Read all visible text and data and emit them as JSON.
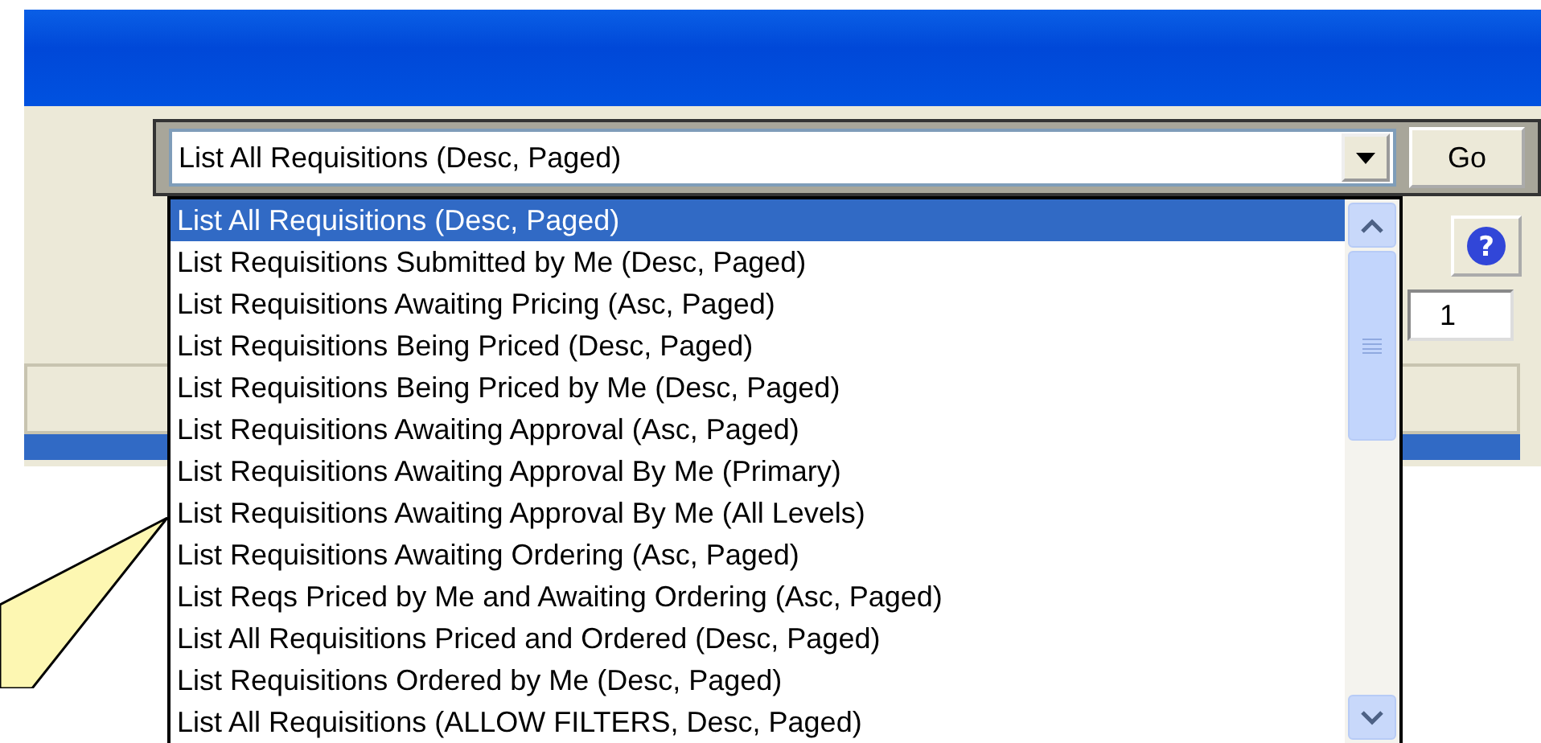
{
  "query_select": {
    "value": "List All Requisitions (Desc, Paged)",
    "expanded": true
  },
  "go_button": {
    "label": "Go"
  },
  "options": [
    {
      "label": "List All Requisitions (Desc, Paged)",
      "selected": true
    },
    {
      "label": "List Requisitions Submitted by Me (Desc, Paged)",
      "selected": false
    },
    {
      "label": "List Requisitions Awaiting Pricing (Asc, Paged)",
      "selected": false
    },
    {
      "label": "List Requisitions Being Priced (Desc, Paged)",
      "selected": false
    },
    {
      "label": "List Requisitions Being Priced by Me (Desc, Paged)",
      "selected": false
    },
    {
      "label": "List Requisitions Awaiting Approval (Asc, Paged)",
      "selected": false
    },
    {
      "label": "List Requisitions Awaiting Approval By Me (Primary)",
      "selected": false
    },
    {
      "label": "List Requisitions Awaiting Approval By Me (All Levels)",
      "selected": false
    },
    {
      "label": "List Requisitions Awaiting Ordering (Asc, Paged)",
      "selected": false
    },
    {
      "label": "List Reqs Priced by Me and Awaiting Ordering (Asc, Paged)",
      "selected": false
    },
    {
      "label": "List All Requisitions Priced and Ordered (Desc, Paged)",
      "selected": false
    },
    {
      "label": "List Requisitions Ordered by Me (Desc, Paged)",
      "selected": false
    },
    {
      "label": "List All Requisitions (ALLOW FILTERS, Desc, Paged)",
      "selected": false
    }
  ],
  "help_button": {
    "label": "?"
  },
  "page_field": {
    "value": "1"
  }
}
